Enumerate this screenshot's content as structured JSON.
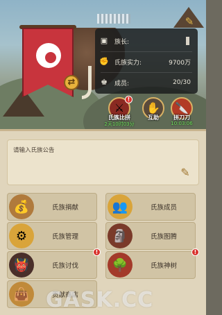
{
  "header": {
    "clan_name_redacted": "",
    "edit_name_icon": "brush-icon"
  },
  "info": {
    "leader_label": "族长:",
    "strength_label": "氏族实力:",
    "strength_value": "9700万",
    "members_label": "成员:",
    "members_value": "20/30"
  },
  "activities": [
    {
      "label": "氏族比拼",
      "time": "2天10时03分",
      "badge": "!"
    },
    {
      "label": "互助",
      "time": ""
    },
    {
      "label": "拼刀刀",
      "time": "10:03:06"
    }
  ],
  "notice": {
    "placeholder": "请输入氏族公告"
  },
  "menu": {
    "donate": "氏族捐献",
    "members": "氏族成员",
    "manage": "氏族管理",
    "totem": "氏族图腾",
    "crusade": "氏族讨伐",
    "tree": "氏族神树",
    "shop": "贡献商店"
  },
  "badges": {
    "crusade": "!",
    "tree": "!"
  },
  "watermark": "GASK.CC",
  "colors": {
    "banner_red": "#c8343d",
    "timer_green": "#6ee35c",
    "badge_red": "#d8312b",
    "parchment": "#e0d5bc"
  }
}
